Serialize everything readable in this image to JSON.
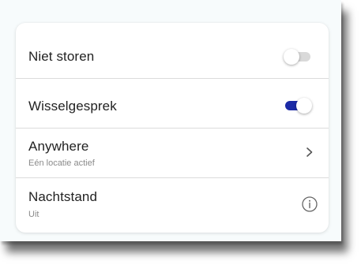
{
  "settings": {
    "items": [
      {
        "label": "Niet storen",
        "toggle_state": "off"
      },
      {
        "label": "Wisselgesprek",
        "toggle_state": "on"
      },
      {
        "label": "Anywhere",
        "sublabel": "Eén locatie actief",
        "icon": "chevron-right-icon"
      },
      {
        "label": "Nachtstand",
        "sublabel": "Uit",
        "icon": "info-icon"
      }
    ]
  },
  "colors": {
    "toggle_on": "#1b2aa6",
    "toggle_off": "#d9d9d9",
    "text_primary": "#222222",
    "text_secondary": "#8a8a8a",
    "divider": "#dcdcdc"
  }
}
